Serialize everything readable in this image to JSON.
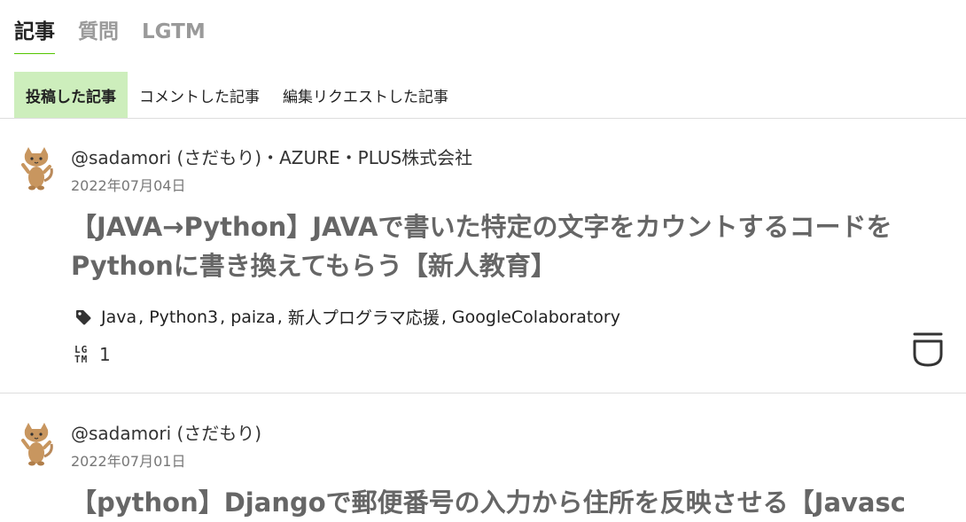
{
  "tabs": {
    "articles": "記事",
    "questions": "質問",
    "lgtm": "LGTM"
  },
  "subtabs": {
    "posted": "投稿した記事",
    "commented": "コメントした記事",
    "edit_requested": "編集リクエストした記事"
  },
  "articles": [
    {
      "author": "@sadamori (さだもり)・AZURE・PLUS株式会社",
      "date": "2022年07月04日",
      "title": "【JAVA→Python】JAVAで書いた特定の文字をカウントするコードをPythonに書き換えてもらう【新人教育】",
      "tags": [
        "Java",
        "Python3",
        "paiza",
        "新人プログラマ応援",
        "GoogleColaboratory"
      ],
      "lgtm_count": "1"
    },
    {
      "author": "@sadamori (さだもり)",
      "date": "2022年07月01日",
      "title": "【python】Djangoで郵便番号の入力から住所を反映させる【Javasc"
    }
  ],
  "icons": {
    "lgtm": "LG\nTM",
    "tag": "tag-icon",
    "stock": "stock-icon",
    "avatar": "cat-avatar"
  },
  "colors": {
    "accent": "#55c500",
    "subtab_active_bg": "#cdeebc"
  }
}
